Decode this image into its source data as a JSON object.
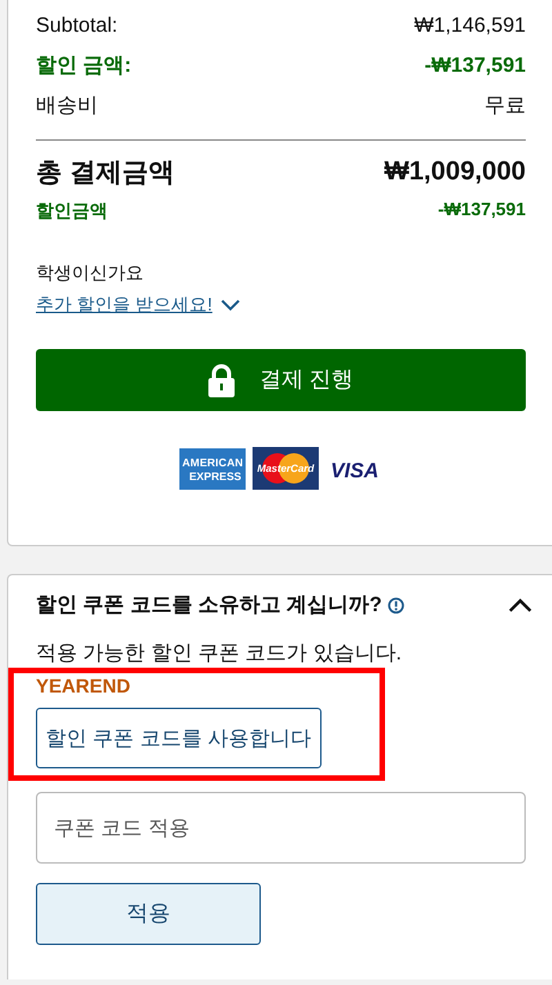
{
  "summary": {
    "lines": [
      {
        "kind": "normal",
        "label": "Subtotal:",
        "value": "₩1,146,591"
      },
      {
        "kind": "discount",
        "label": "할인 금액:",
        "value": "-₩137,591"
      },
      {
        "kind": "normal",
        "label": "배송비",
        "value": "무료"
      }
    ],
    "total": {
      "label": "총 결제금액",
      "value": "₩1,009,000"
    },
    "savings": {
      "label": "할인금액",
      "value": "-₩137,591"
    },
    "student": {
      "question": "학생이신가요",
      "link": "추가 할인을 받으세요!",
      "expanded": false
    },
    "checkout_button": "결제 진행",
    "payment_logos": [
      {
        "kind": "amex",
        "lines": [
          "AMERICAN",
          "EXPRESS"
        ]
      },
      {
        "kind": "mastercard",
        "lines": [
          "MasterCard"
        ]
      },
      {
        "kind": "visa",
        "lines": [
          "VISA"
        ]
      }
    ]
  },
  "coupon": {
    "title": "할인 쿠폰 코드를 소유하고 계십니까?",
    "expanded": true,
    "notice": "적용 가능한 할인 쿠폰 코드가 있습니다.",
    "offers": [
      {
        "code": "YEAREND",
        "button": "할인 쿠폰 코드를 사용합니다",
        "highlighted": true
      }
    ],
    "input": {
      "placeholder": "쿠폰 코드 적용"
    },
    "apply_button": "적용"
  }
}
